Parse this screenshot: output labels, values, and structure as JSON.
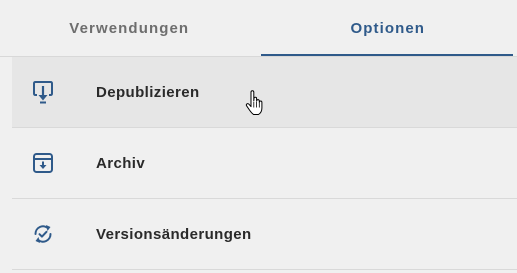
{
  "tabs": [
    {
      "label": "Verwendungen",
      "active": false
    },
    {
      "label": "Optionen",
      "active": true
    }
  ],
  "options": [
    {
      "label": "Depublizieren",
      "icon": "unpublish-icon",
      "hover": true
    },
    {
      "label": "Archiv",
      "icon": "archive-icon",
      "hover": false
    },
    {
      "label": "Versionsänderungen",
      "icon": "version-changes-icon",
      "hover": false
    }
  ],
  "colors": {
    "accent": "#2f5a8a",
    "background": "#f0f0f0",
    "hover": "#e6e6e6",
    "icon": "#2f5a8a"
  }
}
